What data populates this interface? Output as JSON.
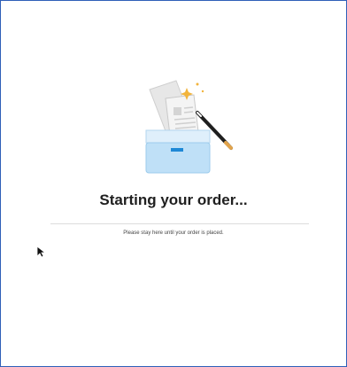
{
  "order_status": {
    "heading": "Starting your order...",
    "message": "Please stay here until your order is placed.",
    "illustration_icon": "documents-magic-wand-tray-icon"
  },
  "colors": {
    "frame_border": "#2f5fb8",
    "tray_blue": "#bfe0f7",
    "accent_blue": "#1e88d6",
    "sparkle": "#f2b43c"
  },
  "cursor_icon": "mouse-pointer-icon"
}
